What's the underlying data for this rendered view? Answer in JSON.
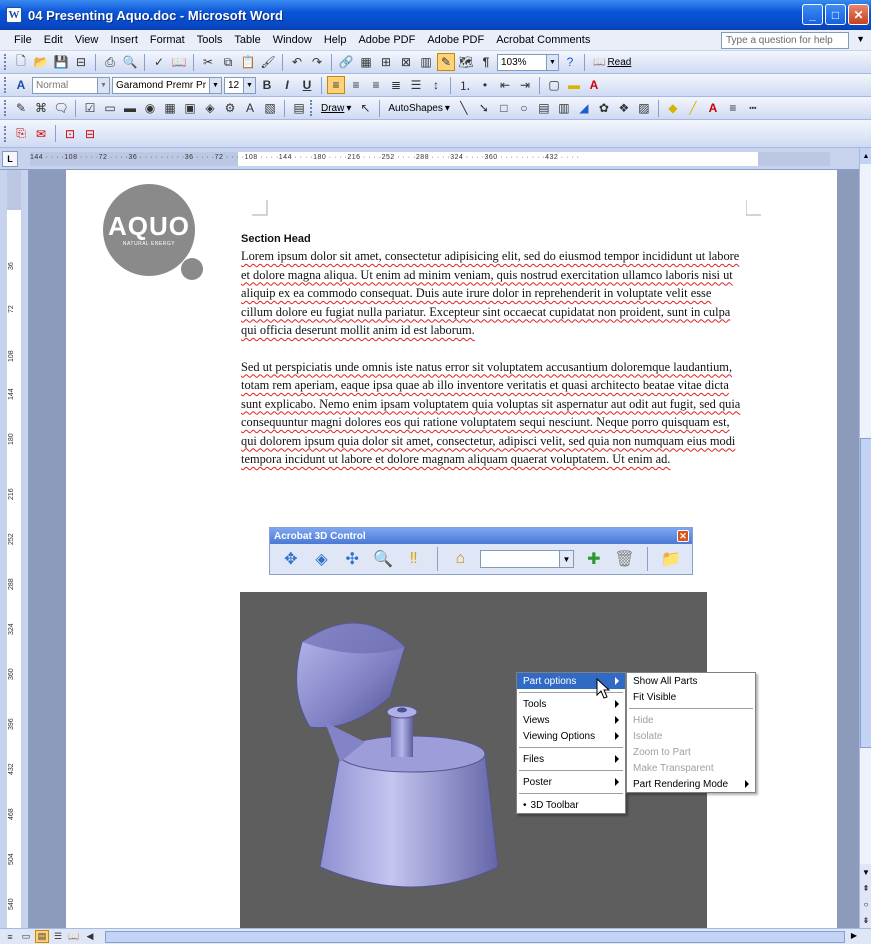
{
  "window": {
    "title": "04 Presenting Aquo.doc - Microsoft Word",
    "min": "_",
    "max": "□",
    "close": "✕"
  },
  "menubar": {
    "items": [
      "File",
      "Edit",
      "View",
      "Insert",
      "Format",
      "Tools",
      "Table",
      "Window",
      "Help",
      "Adobe PDF",
      "Adobe PDF",
      "Acrobat Comments"
    ],
    "help_placeholder": "Type a question for help"
  },
  "toolbar_standard": {
    "zoom": "103%",
    "read_label": "Read"
  },
  "toolbar_format": {
    "style": "Normal",
    "font": "Garamond Premr Pr",
    "size": "12",
    "bold": "B",
    "italic": "I",
    "underline": "U"
  },
  "toolbar_drawing": {
    "draw_label": "Draw",
    "autoshapes_label": "AutoShapes"
  },
  "ruler": {
    "marks": "144 · · · ·108 · · · ·72 · · · ·36 · · · · ·  · · · ·36 · · · ·72 · · · ·108 · · · ·144 · · · ·180 · · · ·216 · · · ·252 · · · ·288 · · · ·324 · · · ·360 · · · · · · · · ·432 · · · ·",
    "tab_selector": "L"
  },
  "vruler": {
    "labels": [
      "36",
      "72",
      "108",
      "144",
      "180",
      "216",
      "252",
      "288",
      "324",
      "360",
      "396",
      "432",
      "468",
      "504",
      "540"
    ]
  },
  "logo": {
    "name": "AQUO",
    "tagline": "NATURAL ENERGY"
  },
  "document": {
    "section_head": "Section Head",
    "para1": "Lorem ipsum dolor sit amet, consectetur adipisicing elit, sed do eiusmod tempor incididunt ut labore et dolore magna aliqua. Ut enim ad minim veniam, quis nostrud exercitation ullamco laboris nisi ut aliquip ex ea commodo consequat. Duis aute irure dolor in reprehenderit in voluptate velit esse cillum dolore eu fugiat nulla pariatur. Excepteur sint occaecat cupidatat non proident, sunt in culpa qui officia deserunt mollit anim id est laborum.",
    "para2": "Sed ut perspiciatis unde omnis iste natus error sit voluptatem accusantium doloremque laudantium, totam rem aperiam, eaque ipsa quae ab illo inventore veritatis et quasi architecto beatae vitae dicta sunt explicabo. Nemo enim ipsam voluptatem quia voluptas sit aspernatur aut odit aut fugit, sed quia consequuntur magni dolores eos qui ratione voluptatem sequi nesciunt. Neque porro quisquam est, qui dolorem ipsum quia dolor sit amet, consectetur, adipisci velit, sed quia non numquam eius modi tempora incidunt ut labore et dolore magnam aliquam quaerat voluptatem. Ut enim ad."
  },
  "acrobat3d": {
    "title": "Acrobat 3D Control",
    "close": "✕",
    "view_select": ""
  },
  "context_menu": {
    "items": [
      "Part options",
      "Tools",
      "Views",
      "Viewing Options",
      "Files",
      "Poster",
      "3D Toolbar"
    ],
    "toolbar_bullet": "•"
  },
  "submenu": {
    "items": [
      "Show All Parts",
      "Fit Visible",
      "Hide",
      "Isolate",
      "Zoom to Part",
      "Make Transparent",
      "Part Rendering Mode"
    ]
  },
  "colors": {
    "title_bar": "#0a55d8",
    "viewer_bg": "#5e5e5e",
    "menu_highlight": "#316ac5",
    "page_bg": "#8c9bbb"
  }
}
